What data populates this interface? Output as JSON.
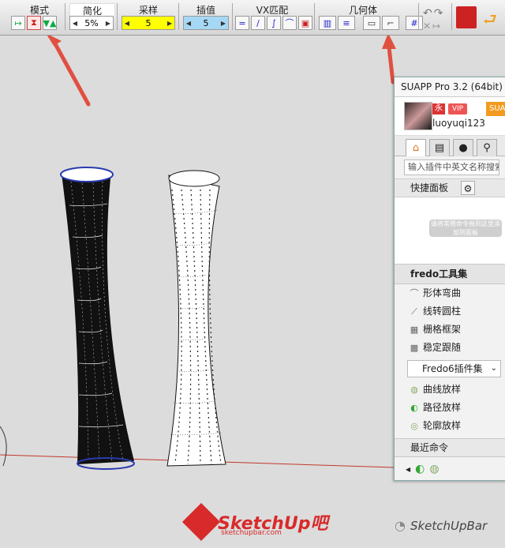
{
  "toolbar": {
    "labels": {
      "mode": "模式",
      "simplify": "简化",
      "sampling": "采样",
      "interpolation": "插值",
      "vx_match": "VX匹配",
      "geometry": "几何体"
    },
    "simplify_value": "5%",
    "sampling_value": "5",
    "interpolation_value": "5"
  },
  "panel": {
    "title": "SUAPP Pro 3.2 (64bit)",
    "user": {
      "name": "luoyuqi123",
      "badge1": "永",
      "badge2": "VIP",
      "badge3": "SUA"
    },
    "search_placeholder": "输入插件中英文名称搜索",
    "quick_panel_label": "快捷面板",
    "quick_blur_text": "请将常用命令拖到这里添加到面板",
    "fredo_title": "fredo工具集",
    "fredo_items": [
      {
        "label": "形体弯曲"
      },
      {
        "label": "线转圆柱"
      },
      {
        "label": "栅格框架"
      },
      {
        "label": "稳定跟随"
      }
    ],
    "dropdown_label": "Fredo6插件集",
    "fredo6_items": [
      {
        "label": "曲线放样"
      },
      {
        "label": "路径放样"
      },
      {
        "label": "轮廓放样"
      }
    ],
    "recent_label": "最近命令"
  },
  "watermark": {
    "brand": "SketchUp吧",
    "url": "sketchupbar.com",
    "wechat": "SketchUpBar"
  },
  "colors": {
    "arrow": "#e05040",
    "panel_accent": "#f39a1e",
    "highlight_yellow": "#ffff00",
    "highlight_blue": "#a6d8f5",
    "axis_red": "#c0392b"
  }
}
